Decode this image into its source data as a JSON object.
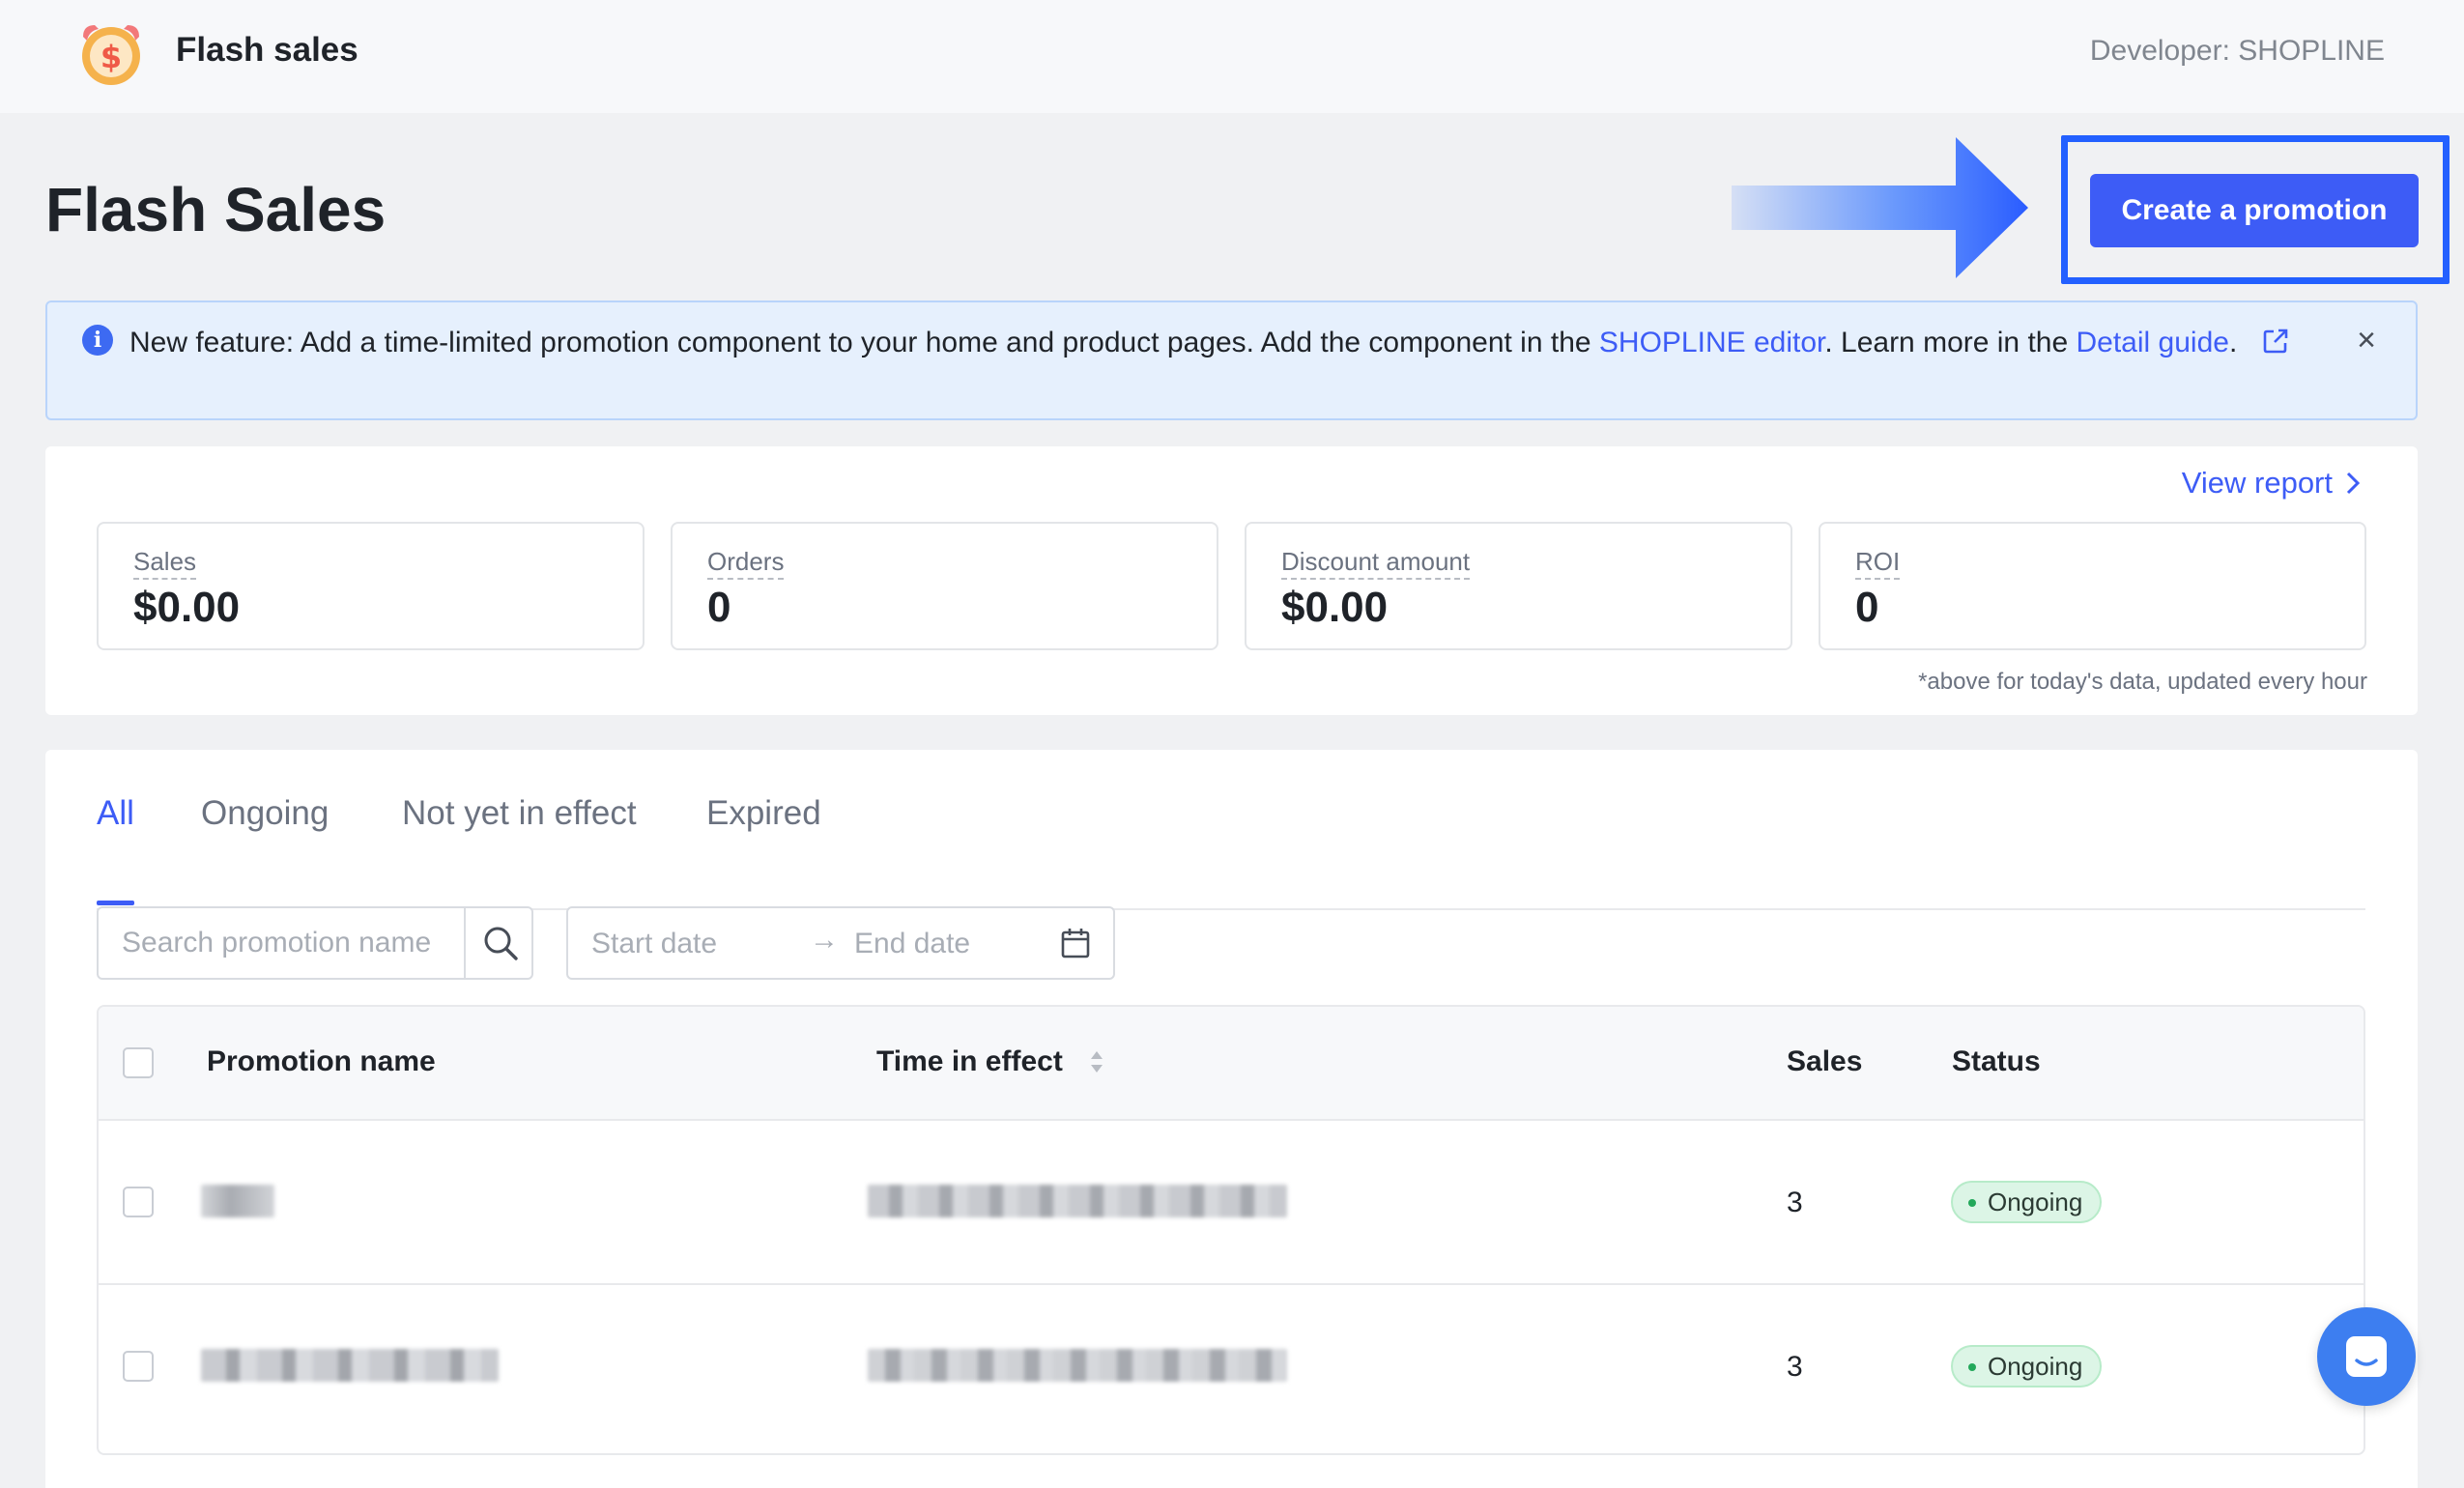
{
  "topbar": {
    "app_name": "Flash sales",
    "developer": "Developer: SHOPLINE",
    "logo_icon": "alarm-clock-dollar-icon"
  },
  "header": {
    "title": "Flash Sales",
    "create_button": "Create a promotion",
    "accent_color": "#3d5cf6"
  },
  "notice": {
    "text_1": "New feature: Add a time-limited promotion component to your home and product pages. Add the component in the ",
    "link_editor": "SHOPLINE editor",
    "text_2": ". Learn more in the ",
    "link_guide": "Detail guide",
    "text_3": ".",
    "close": "×"
  },
  "stats": {
    "view_report": "View report",
    "items": [
      {
        "label": "Sales",
        "value": "$0.00"
      },
      {
        "label": "Orders",
        "value": "0"
      },
      {
        "label": "Discount amount",
        "value": "$0.00"
      },
      {
        "label": "ROI",
        "value": "0"
      }
    ],
    "note": "*above for today's data, updated every hour"
  },
  "tabs": [
    "All",
    "Ongoing",
    "Not yet in effect",
    "Expired"
  ],
  "filters": {
    "search_placeholder": "Search promotion name",
    "start_date_placeholder": "Start date",
    "separator": "→",
    "end_date_placeholder": "End date"
  },
  "table": {
    "columns": [
      "Promotion name",
      "Time in effect",
      "Sales",
      "Status"
    ],
    "rows": [
      {
        "sales": "3",
        "status": "Ongoing"
      },
      {
        "sales": "3",
        "status": "Ongoing"
      }
    ],
    "status_color": "#22a85a"
  }
}
